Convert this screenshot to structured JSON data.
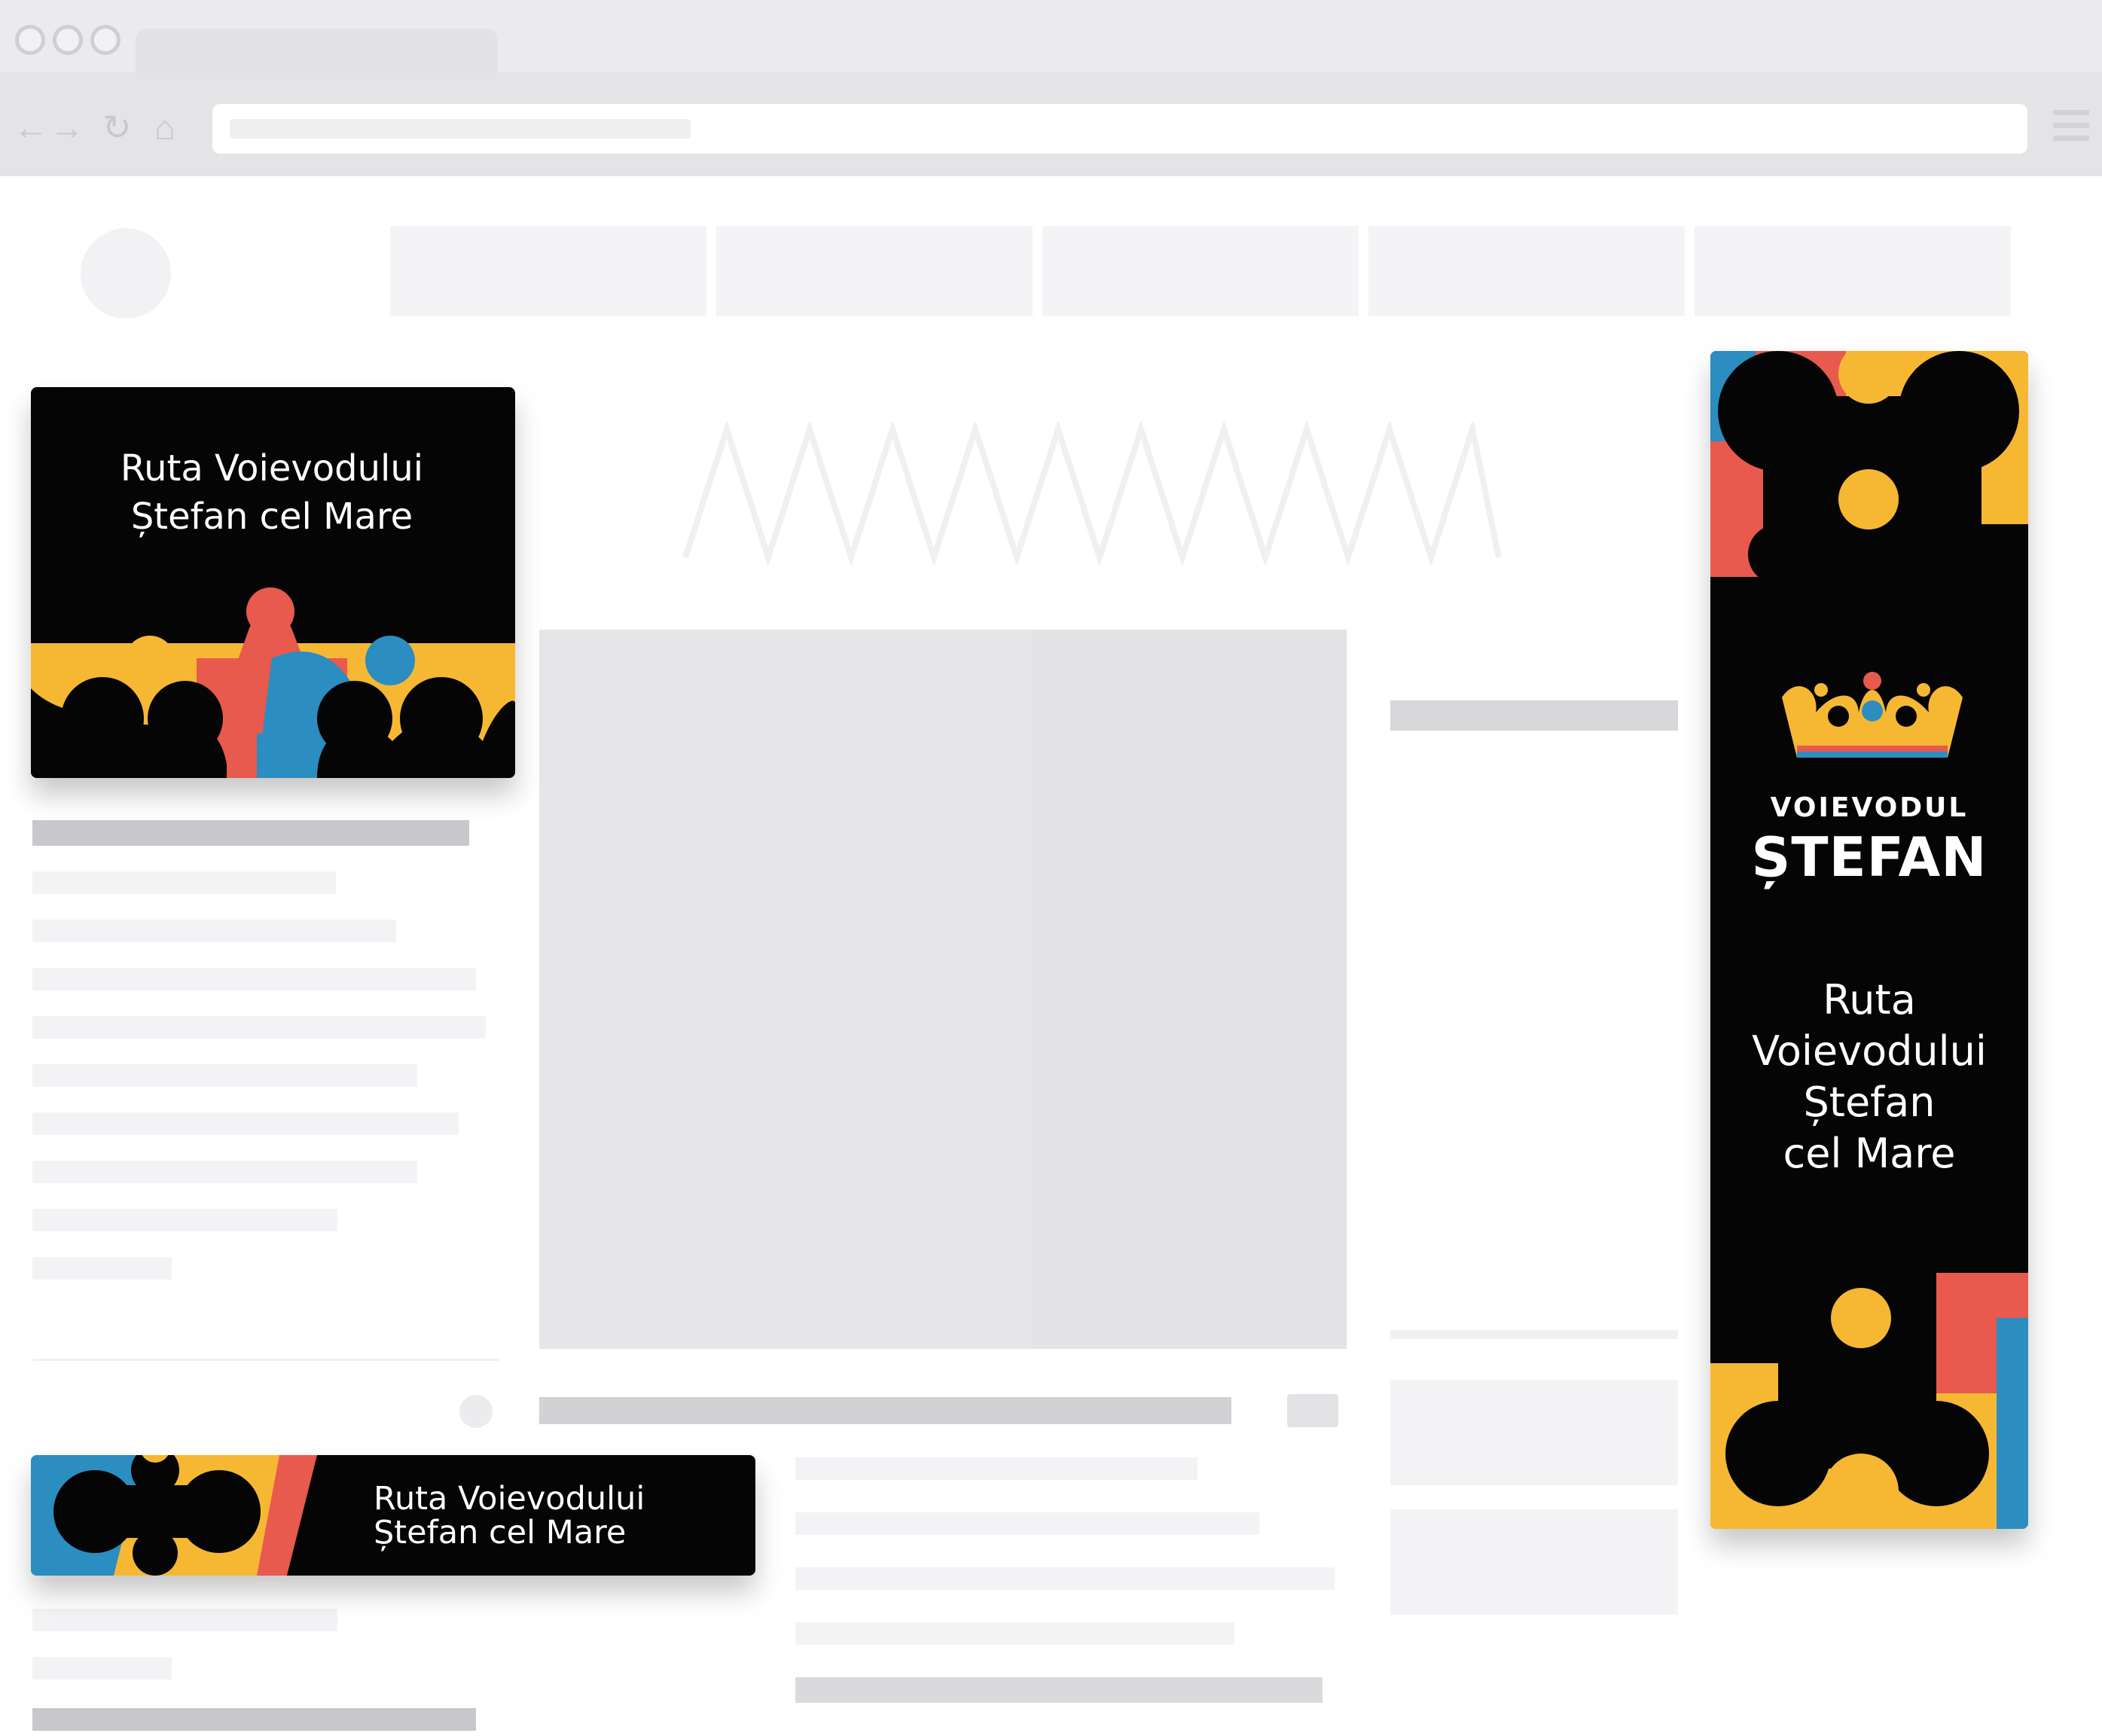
{
  "browser": {
    "window_controls": [
      "close",
      "minimize",
      "maximize"
    ],
    "nav_icons": [
      "back-arrow-icon",
      "forward-arrow-icon",
      "reload-icon",
      "home-icon"
    ],
    "menu_icon": "hamburger-menu-icon"
  },
  "banners": {
    "square": {
      "line1": "Ruta Voievodului",
      "line2": "Ștefan cel Mare"
    },
    "leaderboard": {
      "line1": "Ruta Voievodului",
      "line2": "Ștefan cel Mare"
    },
    "skyscraper": {
      "brand_line1": "VOIEVODUL",
      "brand_line2": "ȘTEFAN",
      "route_lines": [
        "Ruta",
        "Voievodului",
        "Ștefan",
        "cel Mare"
      ]
    }
  },
  "colors": {
    "black": "#050505",
    "yellow": "#f6b833",
    "red": "#e8594e",
    "blue": "#2b8dc0",
    "placeholder": "#e4e4e7"
  }
}
